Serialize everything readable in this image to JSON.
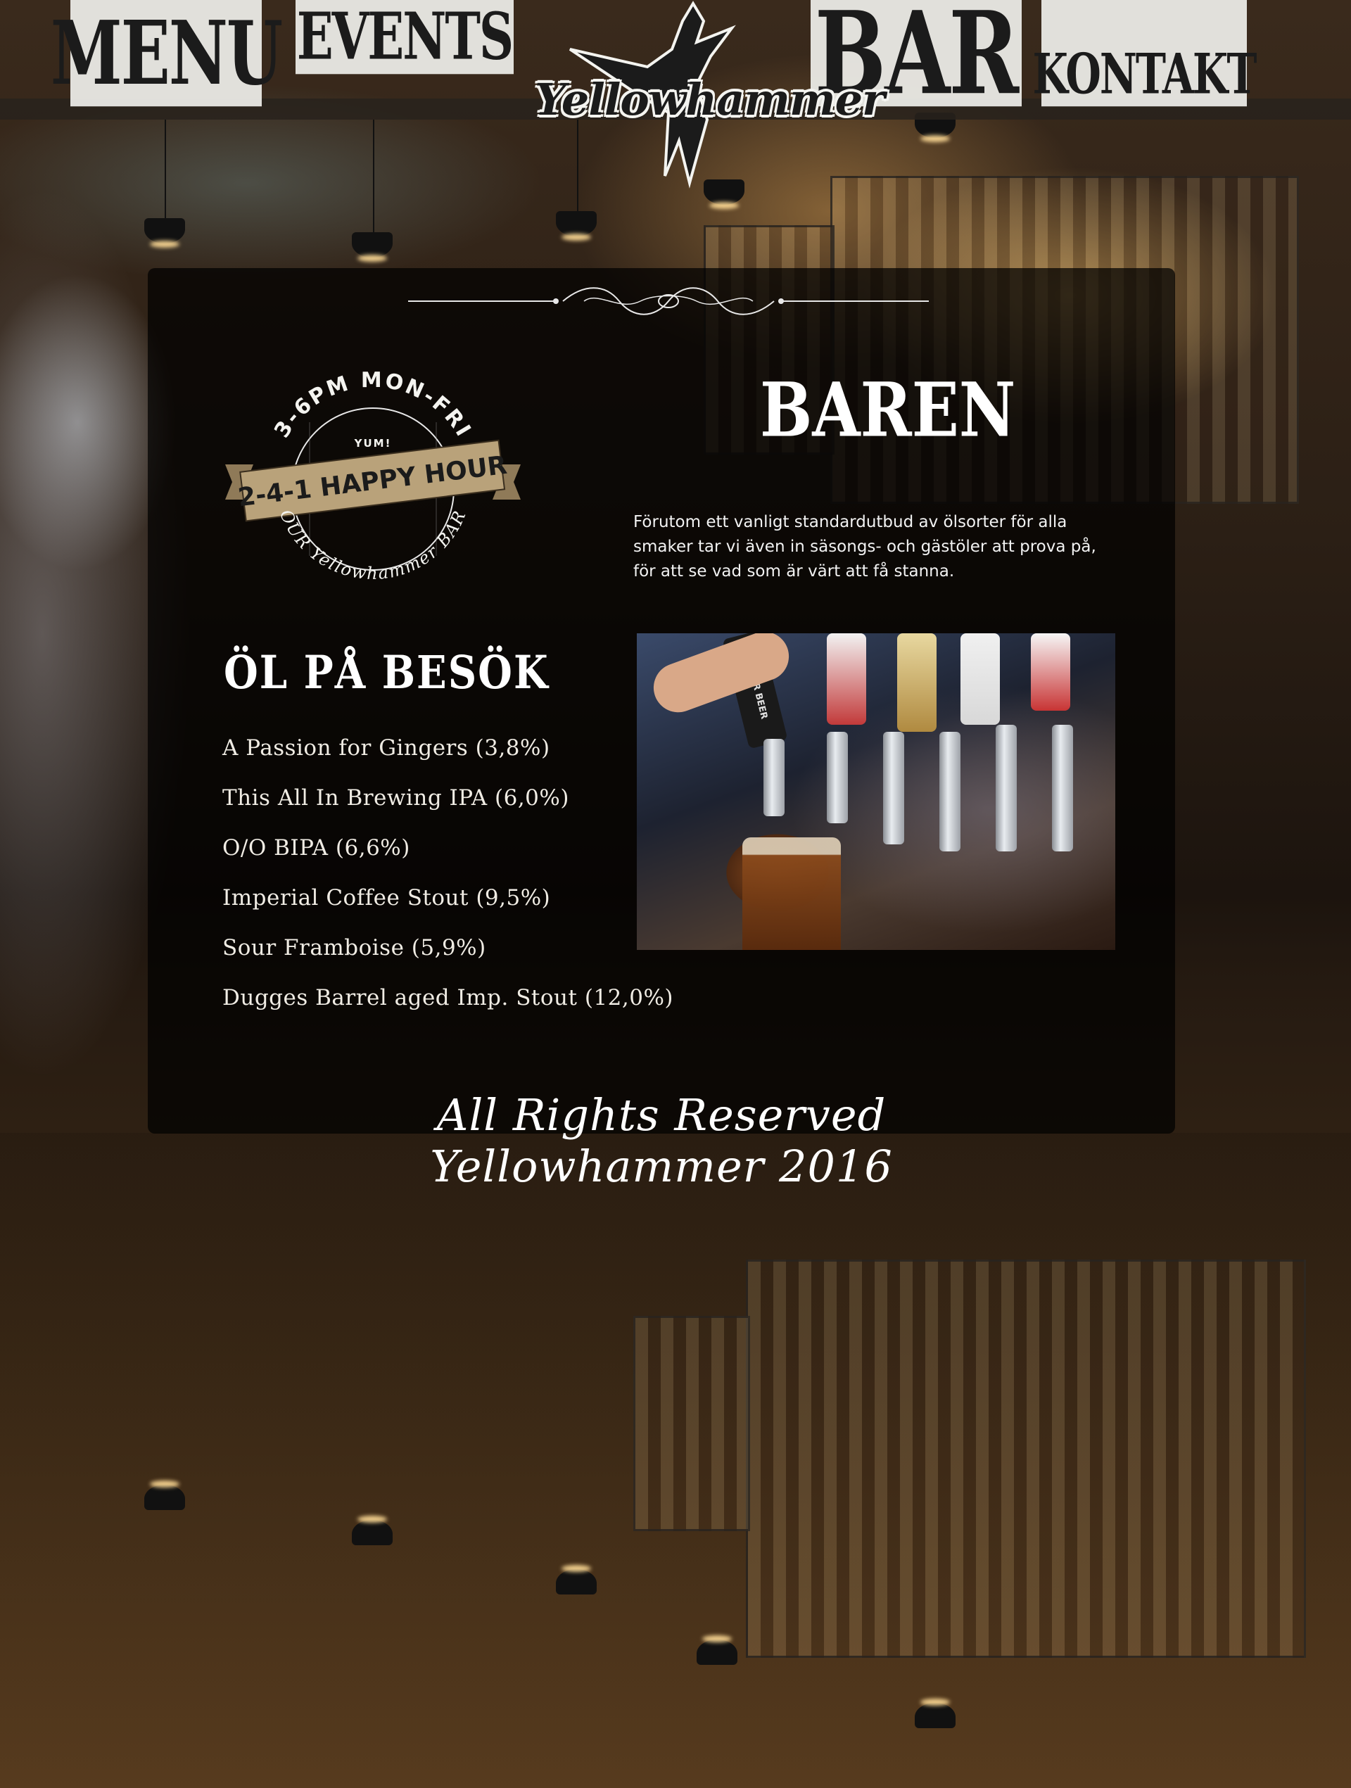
{
  "nav": {
    "menu": "MENU",
    "events": "EVENTS",
    "bar": "BAR",
    "kontakt": "KONTAKT"
  },
  "logo": {
    "text": "Yellowhammer",
    "icon": "bird-icon"
  },
  "happy_hour_badge": {
    "top_text": "3-6PM MON-FRI",
    "small_text": "YUM!",
    "main_text": "2-4-1 HAPPY HOUR",
    "bottom_text": "OUR Yellowhammer BAR"
  },
  "bar_section": {
    "title": "BAREN",
    "intro": "Förutom ett vanligt standardutbud av ölsorter för alla smaker tar vi även in säsongs- och gästöler att prova på, för att se vad som är värt att få stanna."
  },
  "beer_section": {
    "title": "ÖL PÅ BESÖK",
    "beers": [
      "A Passion for Gingers (3,8%)",
      "This All In Brewing IPA (6,0%)",
      "O/O BIPA (6,6%)",
      "Imperial Coffee Stout (9,5%)",
      "Sour Framboise (5,9%)",
      "Dugges Barrel aged Imp. Stout (12,0%)"
    ]
  },
  "tap_photo": {
    "handle_text": "BOULDER BEER"
  },
  "footer": {
    "copyright": "All Rights Reserved Yellowhammer 2016"
  },
  "colors": {
    "nav_tab": "#f0f0ec",
    "panel": "rgba(0,0,0,0.72)",
    "badge_ribbon": "#b9a27a",
    "text_light": "#ffffff"
  }
}
